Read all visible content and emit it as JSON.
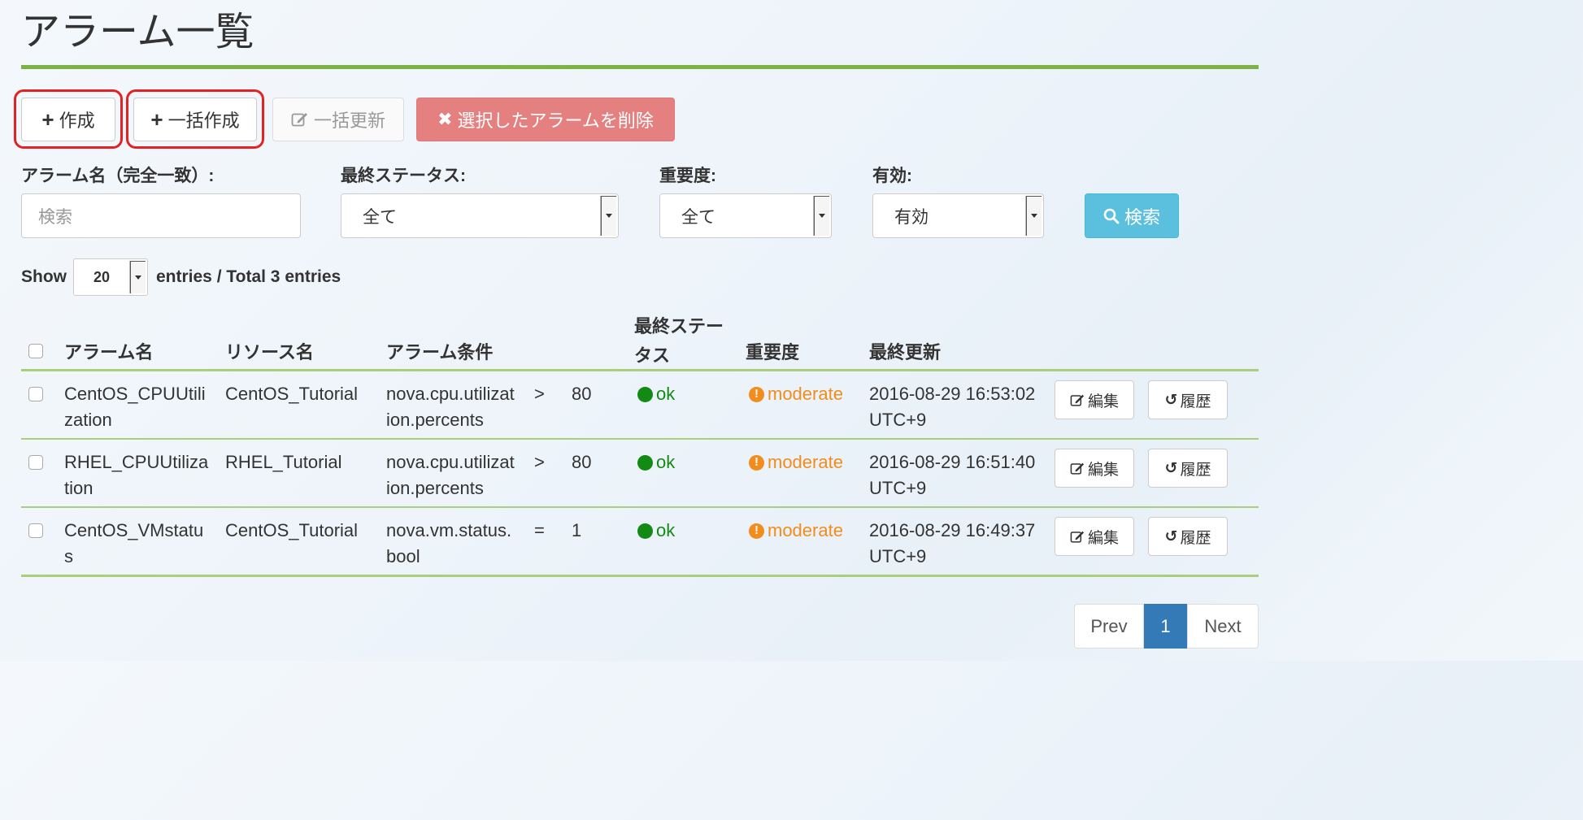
{
  "page": {
    "title": "アラーム一覧"
  },
  "toolbar": {
    "create_label": "作成",
    "bulk_create_label": "一括作成",
    "bulk_update_label": "一括更新",
    "delete_selected_label": "選択したアラームを削除"
  },
  "filters": {
    "name_label": "アラーム名（完全一致）:",
    "name_placeholder": "検索",
    "status_label": "最終ステータス:",
    "status_value": "全て",
    "severity_label": "重要度:",
    "severity_value": "全て",
    "enabled_label": "有効:",
    "enabled_value": "有効",
    "search_label": "検索"
  },
  "entries": {
    "show_label": "Show",
    "page_size": "20",
    "summary": "entries / Total 3 entries"
  },
  "table": {
    "headers": {
      "name": "アラーム名",
      "resource": "リソース名",
      "condition": "アラーム条件",
      "status_line1": "最終ステー",
      "status_line2": "タス",
      "severity": "重要度",
      "updated": "最終更新"
    },
    "rows": [
      {
        "name_l1": "CentOS_CPUUtili",
        "name_l2": "zation",
        "resource": "CentOS_Tutorial",
        "metric_l1": "nova.cpu.utilizat",
        "metric_l2": "ion.percents",
        "op": ">",
        "threshold": "80",
        "status": "ok",
        "severity": "moderate",
        "updated_l1": "2016-08-29 16:53:02",
        "updated_l2": "UTC+9",
        "edit": "編集",
        "history": "履歴"
      },
      {
        "name_l1": "RHEL_CPUUtiliza",
        "name_l2": "tion",
        "resource": "RHEL_Tutorial",
        "metric_l1": "nova.cpu.utilizat",
        "metric_l2": "ion.percents",
        "op": ">",
        "threshold": "80",
        "status": "ok",
        "severity": "moderate",
        "updated_l1": "2016-08-29 16:51:40",
        "updated_l2": "UTC+9",
        "edit": "編集",
        "history": "履歴"
      },
      {
        "name_l1": "CentOS_VMstatu",
        "name_l2": "s",
        "resource": "CentOS_Tutorial",
        "metric_l1": "nova.vm.status.",
        "metric_l2": "bool",
        "op": "=",
        "threshold": "1",
        "status": "ok",
        "severity": "moderate",
        "updated_l1": "2016-08-29 16:49:37",
        "updated_l2": "UTC+9",
        "edit": "編集",
        "history": "履歴"
      }
    ]
  },
  "pagination": {
    "prev": "Prev",
    "current": "1",
    "next": "Next"
  },
  "colors": {
    "accent_rule": "#7cb342",
    "ok": "#138a13",
    "moderate": "#f28c1c",
    "danger": "#e58080",
    "info": "#5bc0de",
    "primary": "#337ab7",
    "highlight": "#e32323"
  }
}
